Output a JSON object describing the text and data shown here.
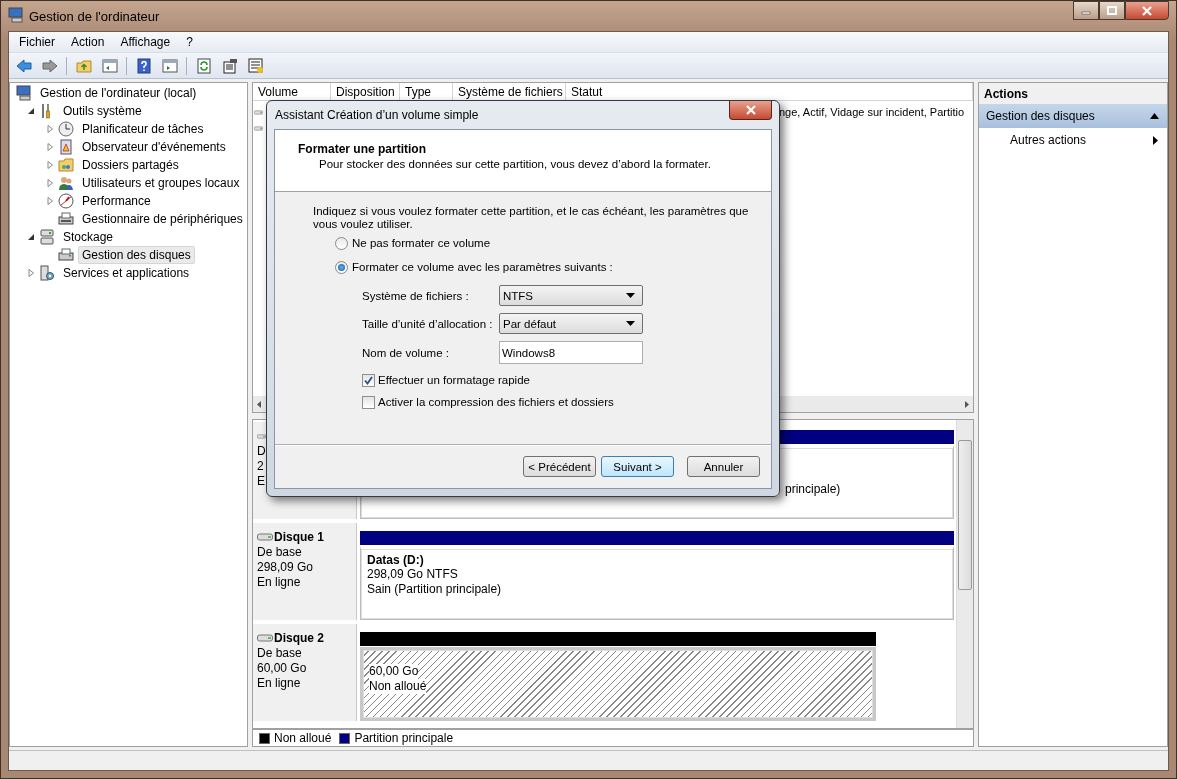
{
  "window": {
    "title": "Gestion de l'ordinateur"
  },
  "menu": [
    "Fichier",
    "Action",
    "Affichage",
    "?"
  ],
  "tree": [
    {
      "label": "Gestion de l'ordinateur (local)",
      "selected": false,
      "children": [
        {
          "label": "Outils système",
          "expanded": true,
          "selected": false,
          "children": [
            {
              "label": "Planificateur de tâches",
              "expanded": false,
              "selected": false
            },
            {
              "label": "Observateur d'événements",
              "expanded": false,
              "selected": false
            },
            {
              "label": "Dossiers partagés",
              "expanded": false,
              "selected": false
            },
            {
              "label": "Utilisateurs et groupes locaux",
              "expanded": false,
              "selected": false
            },
            {
              "label": "Performance",
              "expanded": false,
              "selected": false
            },
            {
              "label": "Gestionnaire de périphériques",
              "selected": false
            }
          ]
        },
        {
          "label": "Stockage",
          "expanded": true,
          "selected": false,
          "children": [
            {
              "label": "Gestion des disques",
              "selected": true
            }
          ]
        },
        {
          "label": "Services et applications",
          "expanded": false,
          "selected": false
        }
      ]
    }
  ],
  "volume_list": {
    "columns": [
      "Volume",
      "Disposition",
      "Type",
      "Système de fichiers",
      "Statut"
    ],
    "rows": [
      {
        "status": "nge, Actif, Vidage sur incident, Partitio"
      },
      {}
    ]
  },
  "disks": [
    {
      "lines": [
        "D",
        "2",
        "E"
      ],
      "partitions": [
        {
          "kind": "partial",
          "color": "#000080",
          "lines": [
            "principale)"
          ]
        }
      ]
    },
    {
      "name": "Disque 1",
      "lines": [
        "De base",
        "298,09 Go",
        "En ligne"
      ],
      "partitions": [
        {
          "kind": "primary",
          "color": "#000080",
          "title": "Datas  (D:)",
          "lines": [
            "298,09 Go NTFS",
            "Sain (Partition principale)"
          ]
        }
      ]
    },
    {
      "name": "Disque 2",
      "lines": [
        "De base",
        "60,00 Go",
        "En ligne"
      ],
      "partitions": [
        {
          "kind": "unallocated",
          "color": "#000000",
          "lines": [
            "60,00 Go",
            "Non alloué"
          ]
        }
      ]
    }
  ],
  "legend": [
    {
      "label": "Non alloué",
      "color": "#000000"
    },
    {
      "label": "Partition principale",
      "color": "#000080"
    }
  ],
  "actions": {
    "title": "Actions",
    "sections": [
      {
        "label": "Gestion des disques",
        "expanded": true,
        "items": [
          "Autres actions"
        ]
      }
    ]
  },
  "dialog": {
    "title": "Assistant Création d’un volume simple",
    "heading": "Formater une partition",
    "subheading": "Pour stocker des données sur cette partition, vous devez d’abord la formater.",
    "instruction": "Indiquez si vous voulez formater cette partition, et le cas échéant, les paramètres que vous voulez utiliser.",
    "radios": [
      {
        "label": "Ne pas formater ce volume",
        "selected": false
      },
      {
        "label": "Formater ce volume avec les paramètres suivants :",
        "selected": true
      }
    ],
    "fields": [
      {
        "kind": "select",
        "label": "Système de fichiers :",
        "value": "NTFS"
      },
      {
        "kind": "select",
        "label": "Taille d’unité d’allocation :",
        "value": "Par défaut"
      },
      {
        "kind": "text",
        "label": "Nom de volume :",
        "value": "Windows8"
      }
    ],
    "checkboxes": [
      {
        "label": "Effectuer un formatage rapide",
        "checked": true
      },
      {
        "label": "Activer la compression des fichiers et dossiers",
        "checked": false
      }
    ],
    "buttons": [
      {
        "label": "< Précédent",
        "default": false
      },
      {
        "label": "Suivant >",
        "default": true
      },
      {
        "label": "Annuler",
        "default": false
      }
    ]
  }
}
